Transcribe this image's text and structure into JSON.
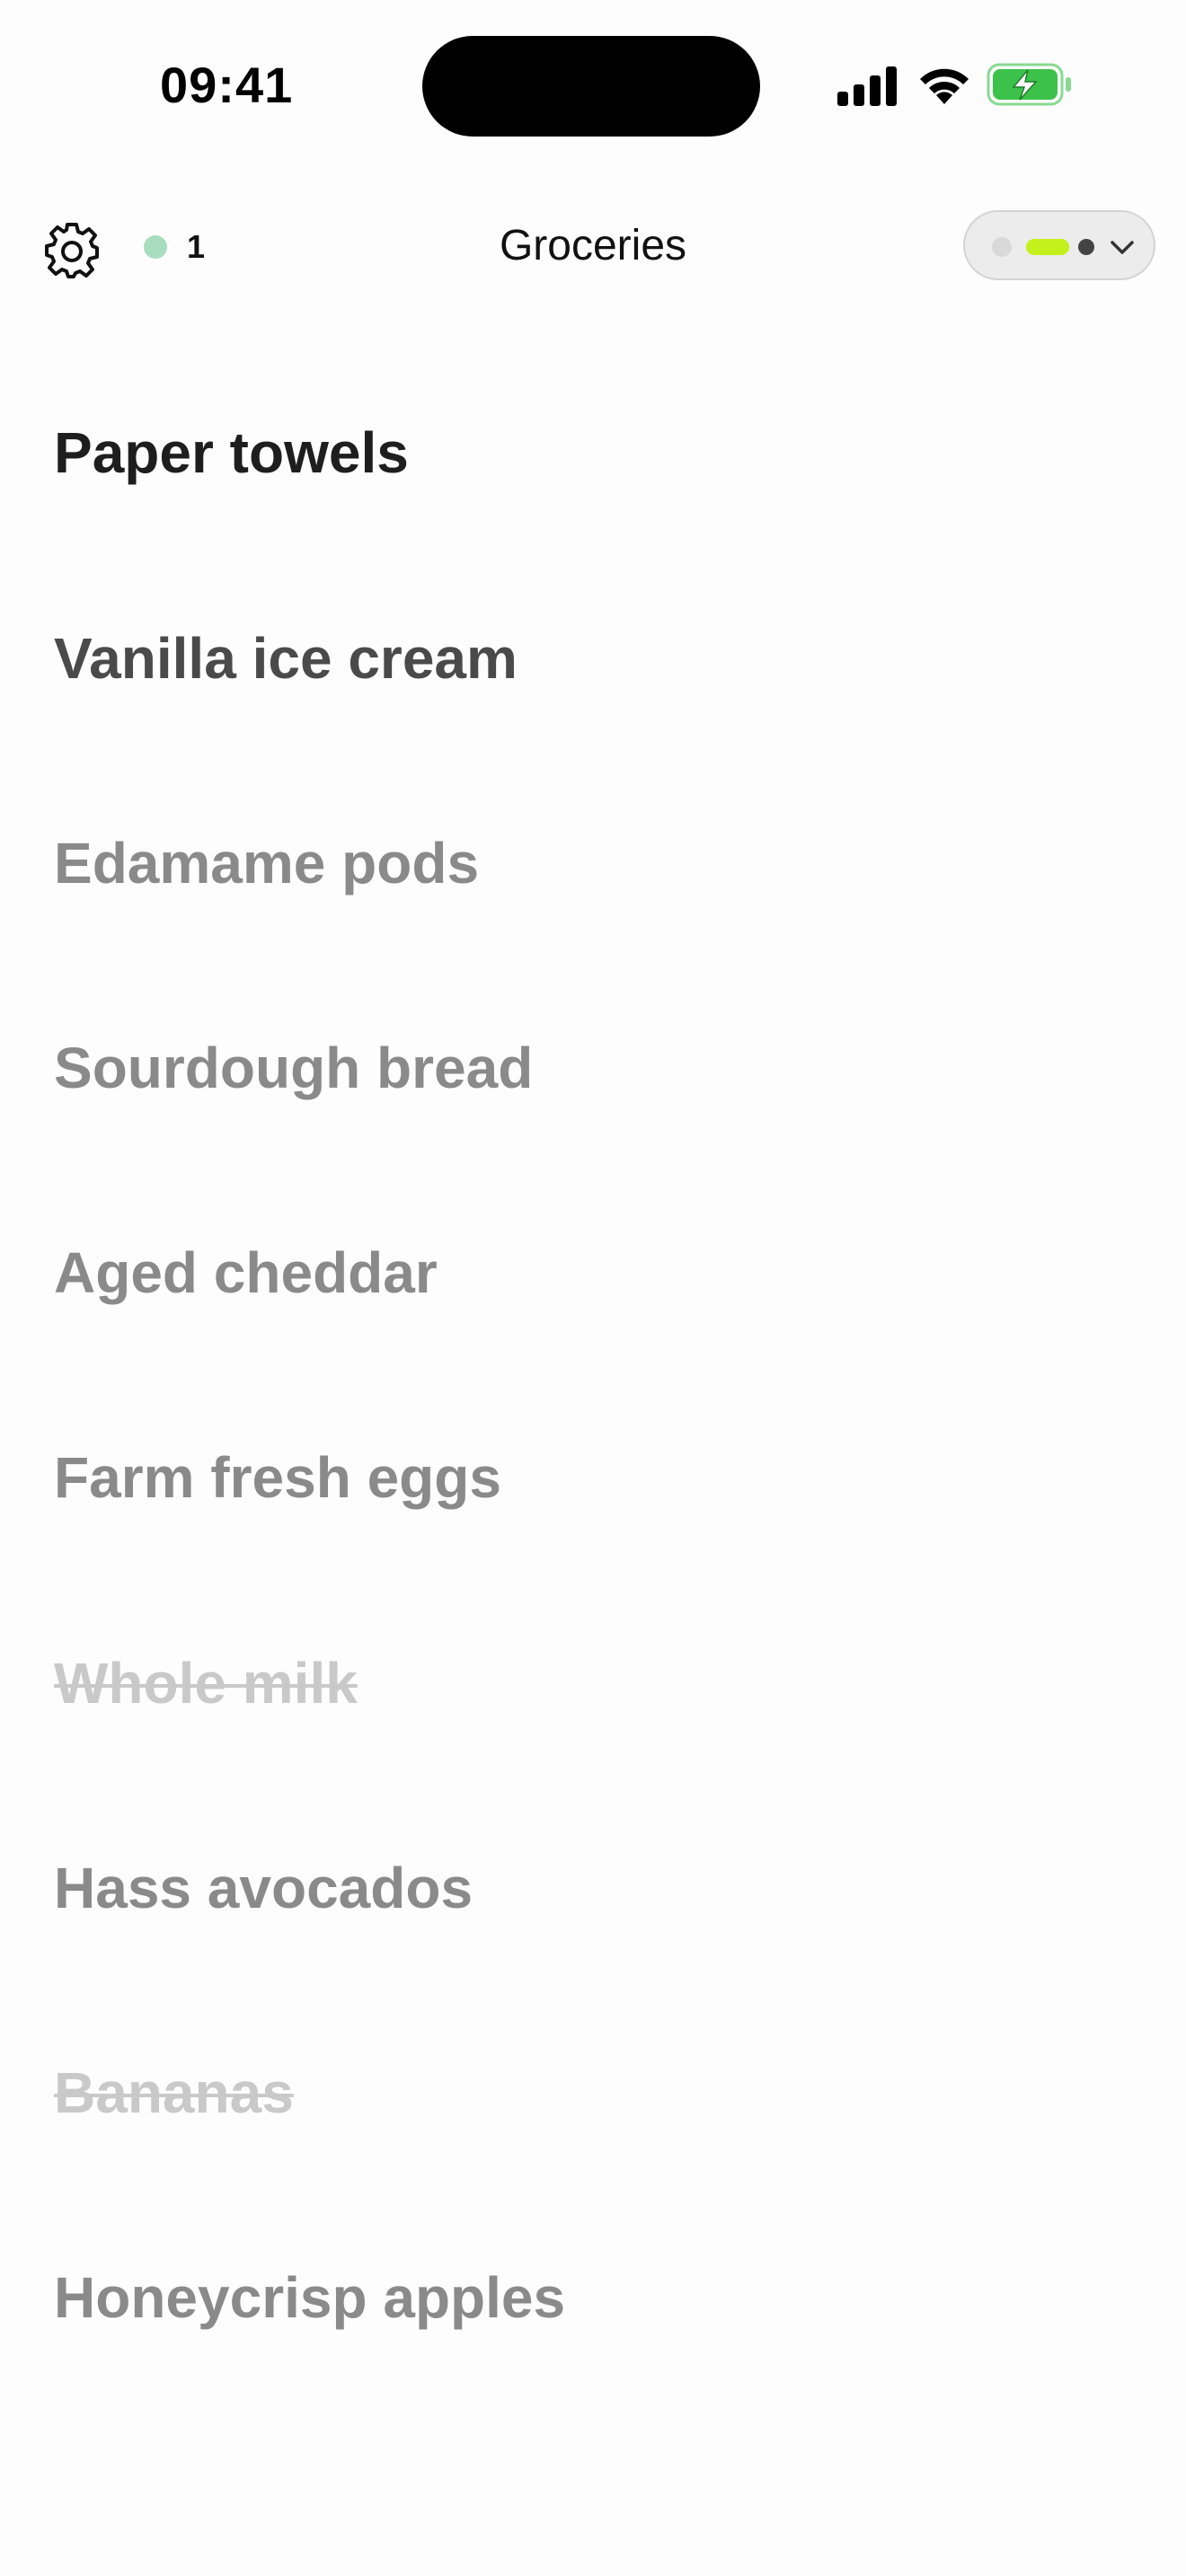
{
  "status_bar": {
    "time": "09:41",
    "signal_icon": "cellular-signal-icon",
    "wifi_icon": "wifi-icon",
    "battery_icon": "battery-charging-icon",
    "battery_color": "#3cc24a"
  },
  "nav": {
    "settings_icon": "gear-icon",
    "presence_count": "1",
    "presence_color": "#a8dcbf",
    "title": "Groceries",
    "view_switcher_icon": "chevron-down-icon",
    "accent_color": "#c4f11b"
  },
  "items": [
    {
      "label": "Paper towels",
      "state": "top"
    },
    {
      "label": "Vanilla ice cream",
      "state": "high"
    },
    {
      "label": "Edamame pods",
      "state": "normal"
    },
    {
      "label": "Sourdough bread",
      "state": "normal"
    },
    {
      "label": "Aged cheddar",
      "state": "normal"
    },
    {
      "label": "Farm fresh eggs",
      "state": "normal"
    },
    {
      "label": "Whole milk",
      "state": "completed"
    },
    {
      "label": "Hass avocados",
      "state": "normal"
    },
    {
      "label": "Bananas",
      "state": "completed"
    },
    {
      "label": "Honeycrisp apples",
      "state": "normal"
    }
  ]
}
